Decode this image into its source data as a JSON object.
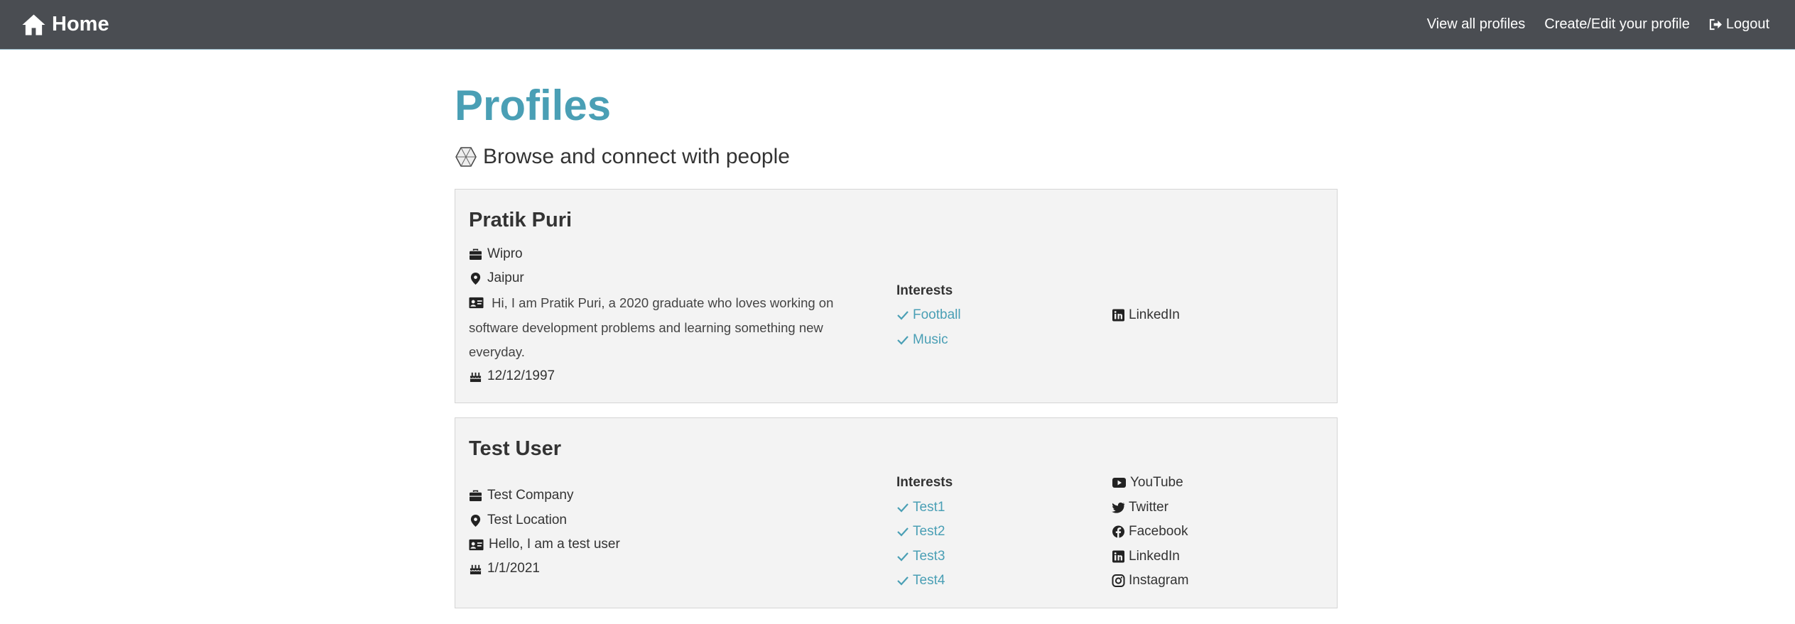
{
  "nav": {
    "brand_label": "Home",
    "links": {
      "view_all": "View all profiles",
      "create_edit": "Create/Edit your profile",
      "logout": "Logout"
    }
  },
  "page": {
    "title": "Profiles",
    "lead": "Browse and connect with people"
  },
  "colors": {
    "navbar": "#4a4d52",
    "accent": "#4a9fb5",
    "card_bg": "#f3f3f3"
  },
  "profiles": [
    {
      "name": "Pratik Puri",
      "company": "Wipro",
      "location": "Jaipur",
      "bio": "Hi, I am Pratik Puri, a 2020 graduate who loves working on software development problems and learning something new everyday.",
      "birthday": "12/12/1997",
      "interests_heading": "Interests",
      "interests": [
        "Football",
        "Music"
      ],
      "socials": [
        "LinkedIn"
      ]
    },
    {
      "name": "Test User",
      "company": "Test Company",
      "location": "Test Location",
      "bio": "Hello, I am a test user",
      "birthday": "1/1/2021",
      "interests_heading": "Interests",
      "interests": [
        "Test1",
        "Test2",
        "Test3",
        "Test4"
      ],
      "socials": [
        "YouTube",
        "Twitter",
        "Facebook",
        "LinkedIn",
        "Instagram"
      ]
    }
  ]
}
